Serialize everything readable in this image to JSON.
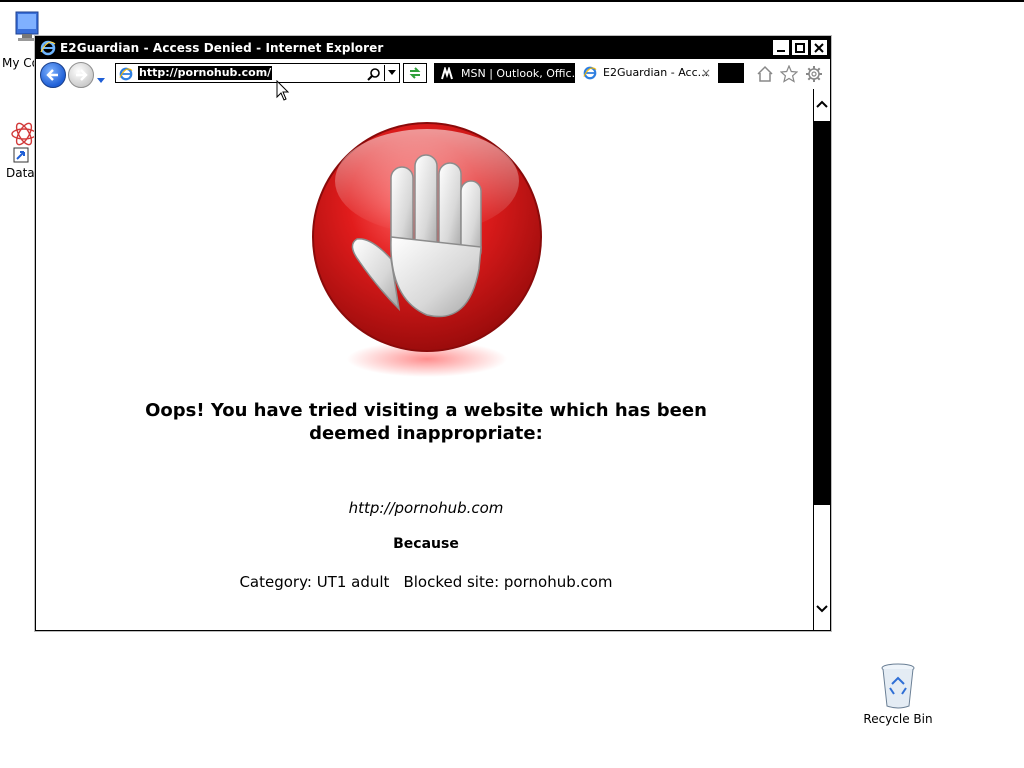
{
  "desktop": {
    "icons": [
      {
        "label": "My Co"
      },
      {
        "label": "Data"
      },
      {
        "label": "Recycle Bin"
      }
    ]
  },
  "window": {
    "title": "E2Guardian - Access Denied - Internet Explorer",
    "address": "http://pornohub.com/",
    "tabs": [
      {
        "label": "MSN | Outlook, Offic...",
        "active": false
      },
      {
        "label": "E2Guardian - Acc...",
        "active": true,
        "close": "×"
      }
    ]
  },
  "page": {
    "headline": "Oops! You have tried visiting a website which has been deemed inappropriate:",
    "url": "http://pornohub.com",
    "because": "Because",
    "category": "Category: UT1 adult",
    "blocked_site": "Blocked site: pornohub.com"
  },
  "colors": {
    "stop_red": "#d11a1a",
    "ie_blue": "#1f5fd6",
    "titlebar": "#000000"
  },
  "icons": [
    "computer-icon",
    "data-shortcut-icon",
    "recycle-bin-icon",
    "ie-icon",
    "back-icon",
    "forward-icon",
    "search-icon",
    "refresh-icon",
    "home-icon",
    "favorites-icon",
    "tools-gear-icon",
    "stop-hand-icon"
  ]
}
